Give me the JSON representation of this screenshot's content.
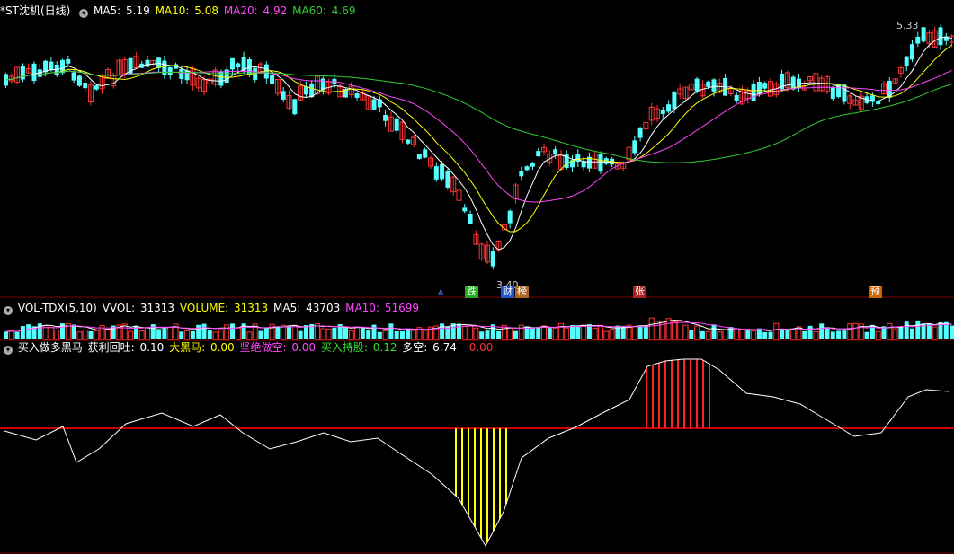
{
  "main": {
    "title": "*ST沈机(日线)",
    "ma": [
      {
        "label": "MA5: ",
        "value": "5.19",
        "color": "#ffffff"
      },
      {
        "label": "MA10: ",
        "value": "5.08",
        "color": "#ffff00"
      },
      {
        "label": "MA20: ",
        "value": "4.92",
        "color": "#ff44ff"
      },
      {
        "label": "MA60: ",
        "value": "4.69",
        "color": "#33cc33"
      }
    ],
    "high_label": "5.33",
    "low_label": "3.40",
    "tags": [
      {
        "text": "⩓",
        "color": "#4488ff",
        "bg": "transparent"
      },
      {
        "text": "跌",
        "color": "#ffffff",
        "bg": "#22aa22"
      },
      {
        "text": "财",
        "color": "#ffffff",
        "bg": "#2255cc"
      },
      {
        "text": "榜",
        "color": "#ffffff",
        "bg": "#aa6622"
      },
      {
        "text": "张",
        "color": "#ffffff",
        "bg": "#aa2222"
      },
      {
        "text": "预",
        "color": "#ffffff",
        "bg": "#cc6600"
      }
    ]
  },
  "volume": {
    "name": "VOL-TDX(5,10)",
    "items": [
      {
        "label": "VVOL: ",
        "value": "31313",
        "color": "#ffffff"
      },
      {
        "label": "VOLUME: ",
        "value": "31313",
        "color": "#ffff00"
      },
      {
        "label": "MA5: ",
        "value": "43703",
        "color": "#ffffff"
      },
      {
        "label": "MA10: ",
        "value": "51699",
        "color": "#ff44ff"
      }
    ]
  },
  "indicator": {
    "name": "买入做多黑马",
    "items": [
      {
        "label": "获利回吐: ",
        "value": "0.10",
        "color": "#ffffff"
      },
      {
        "label": "大黑马: ",
        "value": "0.00",
        "color": "#ffff00"
      },
      {
        "label": "坚绝做空: ",
        "value": "0.00",
        "color": "#ff44ff"
      },
      {
        "label": "买入持股: ",
        "value": "0.12",
        "color": "#33dd33"
      },
      {
        "label": "多空: ",
        "value": "6.74",
        "color": "#ffffff"
      },
      {
        "label": "",
        "value": "0.00",
        "color": "#ff3333"
      }
    ]
  },
  "colors": {
    "up": "#ff3333",
    "down": "#54ffff",
    "grid": "#7a0000",
    "ma5": "#ffffff",
    "ma10": "#ffff00",
    "ma20": "#ff44ff",
    "ma60": "#33cc33"
  }
}
